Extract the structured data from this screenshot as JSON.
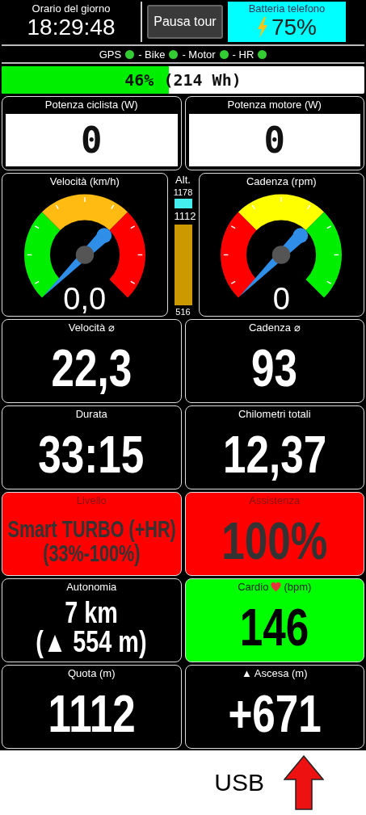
{
  "header": {
    "clock": {
      "title": "Orario del giorno",
      "time": "18:29:48"
    },
    "pause_button": "Pausa tour",
    "phone_battery": {
      "title": "Batteria telefono",
      "value": "75%",
      "charging": true
    }
  },
  "connections": [
    {
      "label": "GPS",
      "connected": true
    },
    {
      "label": "- Bike",
      "connected": true
    },
    {
      "label": "- Motor",
      "connected": true
    },
    {
      "label": "- HR",
      "connected": true
    }
  ],
  "bike_battery": {
    "label": "46% (214 Wh)",
    "level": 0.46
  },
  "power": [
    {
      "title": "Potenza ciclista (W)",
      "value": "0"
    },
    {
      "title": "Potenza motore (W)",
      "value": "0"
    }
  ],
  "gauges": [
    {
      "title": "Velocità (km/h)",
      "value": "0,0",
      "segments": [
        {
          "color": "#00ee00"
        },
        {
          "color": "#ffbb11"
        },
        {
          "color": "#ff0000"
        }
      ]
    },
    {
      "title": "Cadenza (rpm)",
      "value": "0",
      "segments": [
        {
          "color": "#ff0000"
        },
        {
          "color": "#ffff00"
        },
        {
          "color": "#00ee00"
        }
      ]
    }
  ],
  "altitude": {
    "label": "Alt.",
    "max": "1178",
    "current": "1112",
    "min": "516"
  },
  "tiles": [
    {
      "kind": "value",
      "title": "Velocità ⌀",
      "values": [
        "22,3"
      ],
      "color": "#000000"
    },
    {
      "kind": "value",
      "title": "Cadenza ⌀",
      "values": [
        "93"
      ],
      "color": "#000000"
    },
    {
      "kind": "value",
      "title": "Durata",
      "values": [
        "33:15"
      ],
      "color": "#000000"
    },
    {
      "kind": "value",
      "title": "Chilometri totali",
      "values": [
        "12,37"
      ],
      "color": "#000000"
    },
    {
      "kind": "value",
      "title": "Livello",
      "values": [
        "Smart TURBO (+HR)",
        "(33%-100%)"
      ],
      "color": "#ff0000"
    },
    {
      "kind": "value",
      "title": "Assistenza",
      "values": [
        "100%"
      ],
      "color": "#ff0000"
    },
    {
      "kind": "value",
      "title": "Autonomia",
      "values": [
        "7 km",
        "(▲ 554 m)"
      ],
      "color": "#000000"
    },
    {
      "kind": "heart",
      "title": "Cardio",
      "title_suffix": "(bpm)",
      "values": [
        "146"
      ],
      "color": "#00ff00"
    },
    {
      "kind": "value",
      "title": "Quota (m)",
      "values": [
        "1112"
      ],
      "color": "#000000"
    },
    {
      "kind": "value",
      "title": "▲ Ascesa (m)",
      "values": [
        "+671"
      ],
      "color": "#000000"
    }
  ],
  "footer": {
    "label": "USB"
  }
}
